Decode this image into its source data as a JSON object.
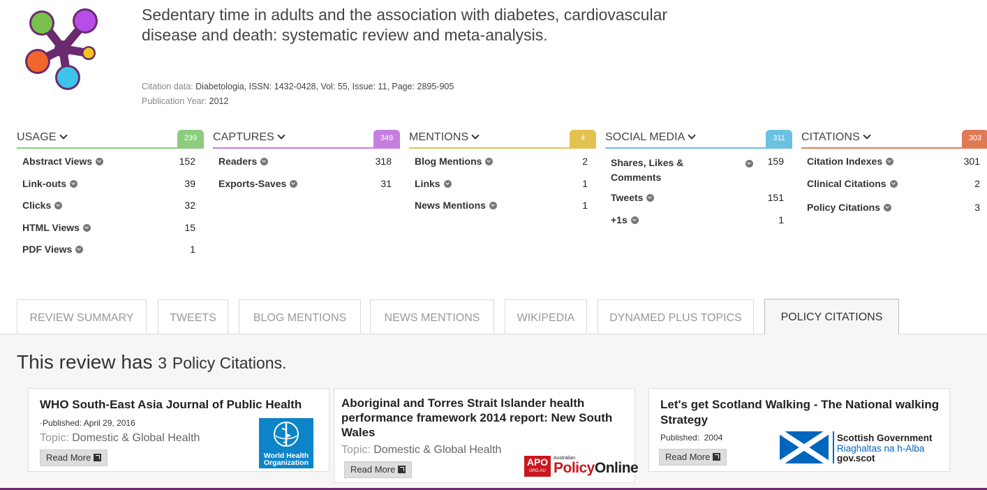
{
  "header": {
    "title": "Sedentary time in adults and the association with diabetes, cardiovascular disease and death: systematic review and meta-analysis.",
    "citation_label": "Citation data:",
    "citation_value": "Diabetologia, ISSN: 1432-0428, Vol: 55, Issue: 11, Page: 2895-905",
    "pubyear_label": "Publication Year:",
    "pubyear_value": "2012"
  },
  "metrics": [
    {
      "title": "USAGE",
      "total": "239",
      "color": "#8ccc7d",
      "rows": [
        {
          "label": "Abstract Views",
          "value": "152"
        },
        {
          "label": "Link-outs",
          "value": "39"
        },
        {
          "label": "Clicks",
          "value": "32"
        },
        {
          "label": "HTML Views",
          "value": "15"
        },
        {
          "label": "PDF Views",
          "value": "1"
        }
      ]
    },
    {
      "title": "CAPTURES",
      "total": "349",
      "color": "#c67fe0",
      "rows": [
        {
          "label": "Readers",
          "value": "318"
        },
        {
          "label": "Exports-Saves",
          "value": "31"
        }
      ]
    },
    {
      "title": "MENTIONS",
      "total": "4",
      "color": "#e3c24f",
      "rows": [
        {
          "label": "Blog Mentions",
          "value": "2"
        },
        {
          "label": "Links",
          "value": "1"
        },
        {
          "label": "News Mentions",
          "value": "1"
        }
      ]
    },
    {
      "title": "SOCIAL MEDIA",
      "total": "311",
      "color": "#6cc0e0",
      "rows": [
        {
          "label": "Shares, Likes & Comments",
          "value": "159"
        },
        {
          "label": "Tweets",
          "value": "151"
        },
        {
          "label": "+1s",
          "value": "1"
        }
      ]
    },
    {
      "title": "CITATIONS",
      "total": "303",
      "color": "#e07a55",
      "rows": [
        {
          "label": "Citation Indexes",
          "value": "301"
        },
        {
          "label": "Clinical Citations",
          "value": "2"
        },
        {
          "label": "Policy Citations",
          "value": "3"
        }
      ]
    }
  ],
  "tabs": [
    "REVIEW SUMMARY",
    "TWEETS",
    "BLOG MENTIONS",
    "NEWS MENTIONS",
    "WIKIPEDIA",
    "DYNAMED PLUS TOPICS",
    "POLICY CITATIONS"
  ],
  "active_tab": "POLICY CITATIONS",
  "summary": {
    "prefix": "This review has",
    "count": "3",
    "suffix": "Policy Citations."
  },
  "cards": [
    {
      "title": "WHO South-East Asia Journal of Public Health",
      "published_label": "Published:",
      "published_value": "April 29, 2016",
      "topic_label": "Topic:",
      "topic_value": "Domestic & Global Health",
      "read_more": "Read More",
      "logo_text": [
        "World Health",
        "Organization"
      ],
      "logo_icon": "who-emblem-icon"
    },
    {
      "title": "Aboriginal and Torres Strait Islander health performance framework 2014 report: New South Wales",
      "topic_label": "Topic:",
      "topic_value": "Domestic & Global Health",
      "read_more": "Read More",
      "logo_box": "APO",
      "logo_box_sub": "ORG.AU",
      "logo_small": "Australian",
      "logo_big_a": "Policy",
      "logo_big_b": "Online"
    },
    {
      "title": "Let's get Scotland Walking - The National walking Strategy",
      "published_label": "Published:",
      "published_value": "2004",
      "read_more": "Read More",
      "logo_lines": [
        "Scottish Government",
        "Riaghaltas na h-Alba",
        "gov.scot"
      ],
      "logo_icon": "saltire-flag-icon"
    }
  ]
}
